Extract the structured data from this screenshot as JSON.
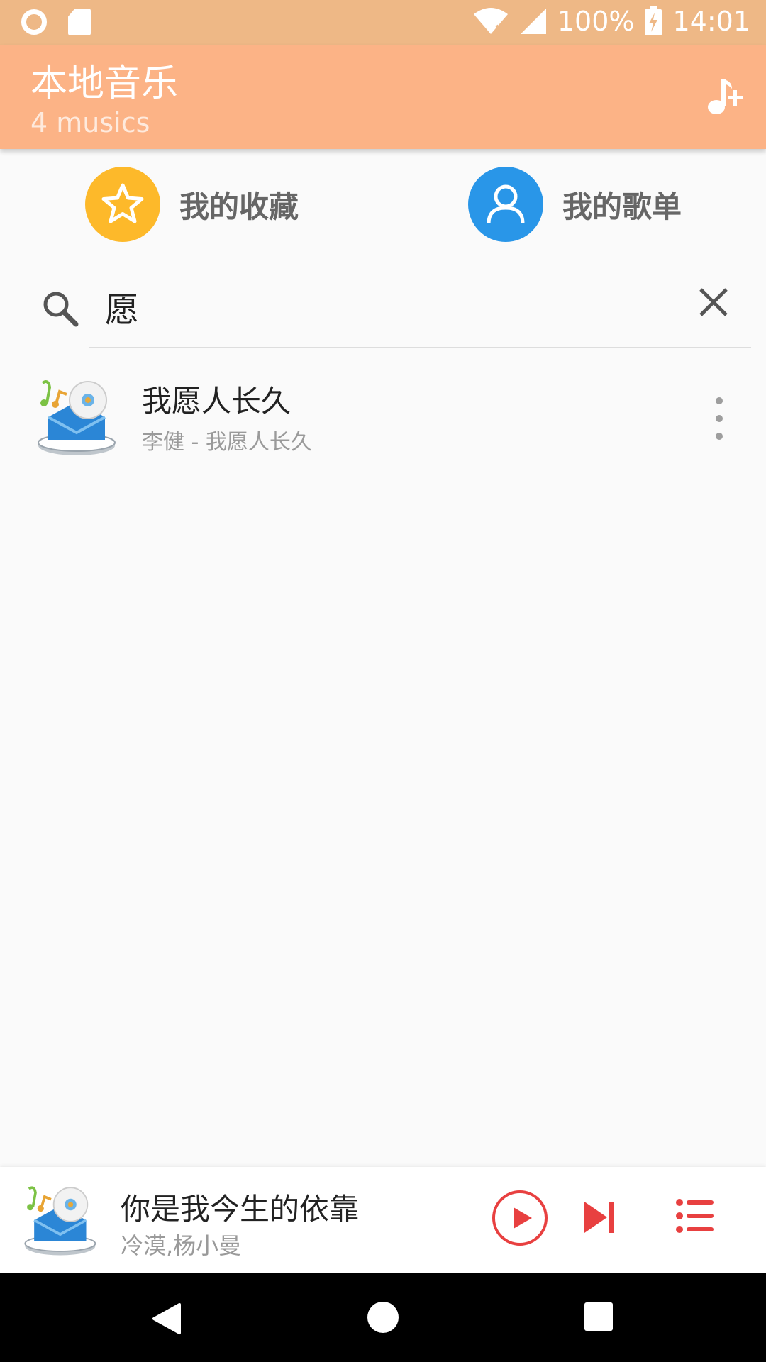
{
  "status_bar": {
    "battery": "100%",
    "time": "14:01"
  },
  "app_bar": {
    "title": "本地音乐",
    "subtitle": "4 musics",
    "add_icon": "music-plus-icon"
  },
  "shortcuts": {
    "favorites": {
      "label": "我的收藏",
      "icon": "star-icon",
      "color": "#FDB92A"
    },
    "playlists": {
      "label": "我的歌单",
      "icon": "person-icon",
      "color": "#2996E8"
    }
  },
  "search": {
    "value": "愿",
    "placeholder": ""
  },
  "songs": [
    {
      "title": "我愿人长久",
      "subtitle": "李健 - 我愿人长久"
    }
  ],
  "mini_player": {
    "title": "你是我今生的依靠",
    "artist": "冷漠,杨小曼",
    "accent": "#E84040"
  },
  "colors": {
    "status_bar": "#EEB886",
    "app_bar": "#FCB386",
    "background": "#FAFAFA"
  }
}
